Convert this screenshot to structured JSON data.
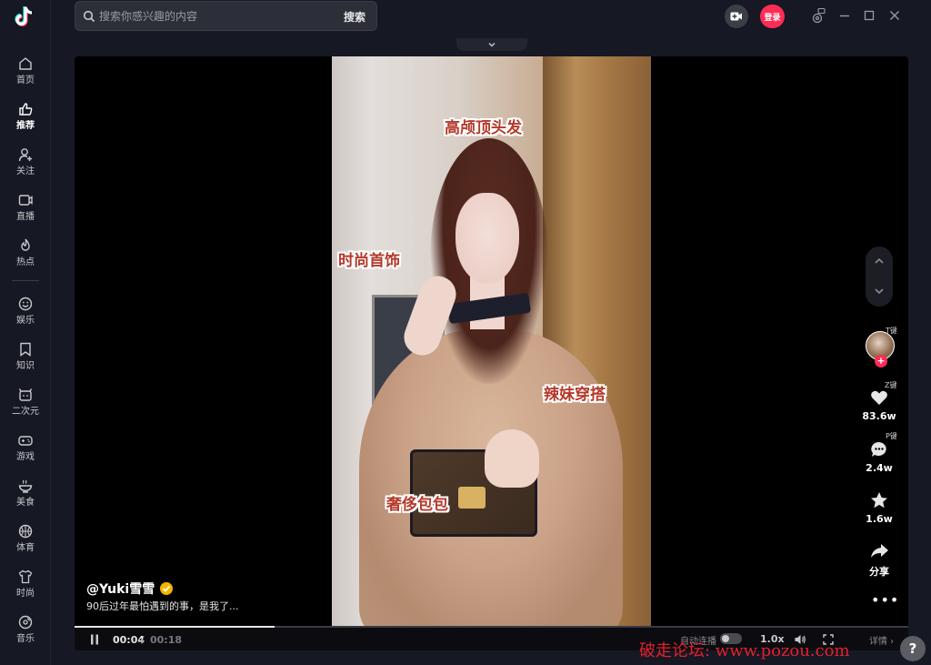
{
  "sidebar": {
    "items": [
      {
        "label": "首页",
        "icon": "home-icon"
      },
      {
        "label": "推荐",
        "icon": "thumbs-up-icon",
        "active": true
      },
      {
        "label": "关注",
        "icon": "user-plus-icon"
      },
      {
        "label": "直播",
        "icon": "live-tv-icon"
      },
      {
        "label": "热点",
        "icon": "flame-icon"
      },
      {
        "label": "娱乐",
        "icon": "smiley-icon"
      },
      {
        "label": "知识",
        "icon": "bookmark-icon"
      },
      {
        "label": "二次元",
        "icon": "anime-icon"
      },
      {
        "label": "游戏",
        "icon": "gamepad-icon"
      },
      {
        "label": "美食",
        "icon": "food-bowl-icon"
      },
      {
        "label": "体育",
        "icon": "basketball-icon"
      },
      {
        "label": "时尚",
        "icon": "shirt-icon"
      },
      {
        "label": "音乐",
        "icon": "music-disc-icon"
      }
    ]
  },
  "search": {
    "placeholder": "搜索你感兴趣的内容",
    "button_label": "搜索"
  },
  "header": {
    "login_label": "登录"
  },
  "video": {
    "overlay_texts": [
      "高颅顶头发",
      "时尚首饰",
      "辣妹穿搭",
      "奢侈包包"
    ],
    "author": "@Yuki雪雪",
    "description": "90后过年最怕遇到的事，是我了..."
  },
  "actions": {
    "follow_key": "T键",
    "like_key": "Z键",
    "comment_key": "P键",
    "likes": "83.6w",
    "comments": "2.4w",
    "favorites": "1.6w",
    "share_label": "分享",
    "more_label": "•••"
  },
  "player": {
    "current_time": "00:04",
    "separator": "/",
    "total_time": "00:18",
    "progress": 0.24,
    "autoplay_label": "自动连播",
    "speed": "1.0x",
    "details_label": "详情 ›"
  },
  "watermark": "破走论坛: www.pozou.com",
  "help_label": "?",
  "colors": {
    "background": "#161823",
    "accent": "#fe2c55",
    "verified": "#f5b400"
  }
}
